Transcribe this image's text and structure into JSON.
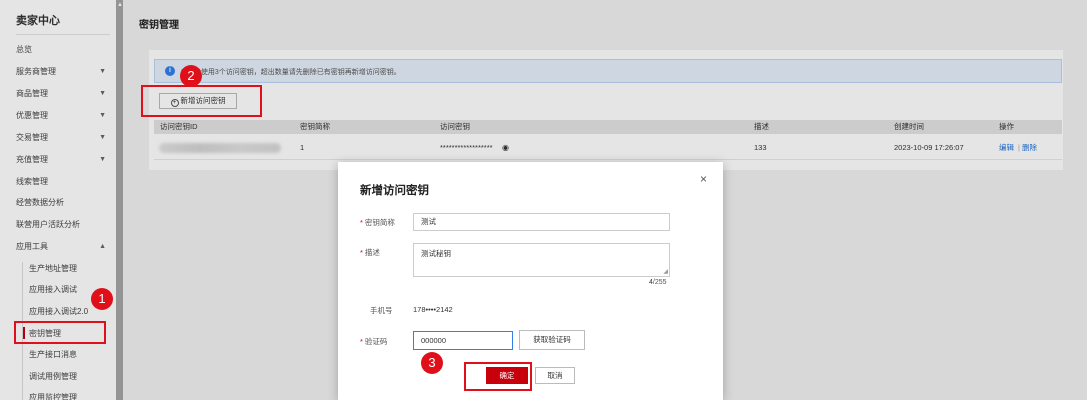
{
  "sidebar": {
    "title": "卖家中心",
    "items": [
      {
        "label": "总览",
        "caret": ""
      },
      {
        "label": "服务商管理",
        "caret": "▼"
      },
      {
        "label": "商品管理",
        "caret": "▼"
      },
      {
        "label": "优惠管理",
        "caret": "▼"
      },
      {
        "label": "交易管理",
        "caret": "▼"
      },
      {
        "label": "充值管理",
        "caret": "▼"
      },
      {
        "label": "线索管理",
        "caret": ""
      },
      {
        "label": "经营数据分析",
        "caret": ""
      },
      {
        "label": "联营用户活跃分析",
        "caret": ""
      },
      {
        "label": "应用工具",
        "caret": "▲"
      }
    ],
    "sub_items": [
      {
        "label": "生产地址管理"
      },
      {
        "label": "应用接入调试"
      },
      {
        "label": "应用接入调试2.0"
      },
      {
        "label": "密钥管理"
      },
      {
        "label": "生产接口消息"
      },
      {
        "label": "调试用例管理"
      },
      {
        "label": "应用监控管理"
      }
    ]
  },
  "page": {
    "title": "密钥管理",
    "info_text": "3 已能使用3个访问密钥，超出数量请先删除已有密钥再新增访问密钥。",
    "info_icon": "i",
    "add_button": "新增访问密钥",
    "add_icon": "+"
  },
  "table": {
    "headers": [
      "访问密钥ID",
      "密钥简称",
      "访问密钥",
      "描述",
      "创建时间",
      "操作"
    ],
    "rows": [
      {
        "name": "1",
        "secret": "******************",
        "desc": "133",
        "created": "2023-10-09 17:26:07",
        "edit": "编辑",
        "sep": "|",
        "delete": "删除"
      }
    ],
    "eye_icon": "◉"
  },
  "modal": {
    "title": "新增访问密钥",
    "close": "×",
    "required_mark": "*",
    "name_label": "密钥简称",
    "name_value": "测试",
    "desc_label": "描述",
    "desc_value": "测试秘钥",
    "desc_count": "4",
    "desc_max": "/255",
    "phone_label": "手机号",
    "phone_value": "178••••2142",
    "code_label": "验证码",
    "code_value": "000000",
    "get_code_button": "获取验证码",
    "ok_button": "确定",
    "cancel_button": "取消"
  },
  "annotations": {
    "step1": "1",
    "step2": "2",
    "step3": "3"
  },
  "colors": {
    "brand_red": "#c7000b",
    "link_blue": "#1e6fd9",
    "annotation_red": "#e0101a"
  }
}
